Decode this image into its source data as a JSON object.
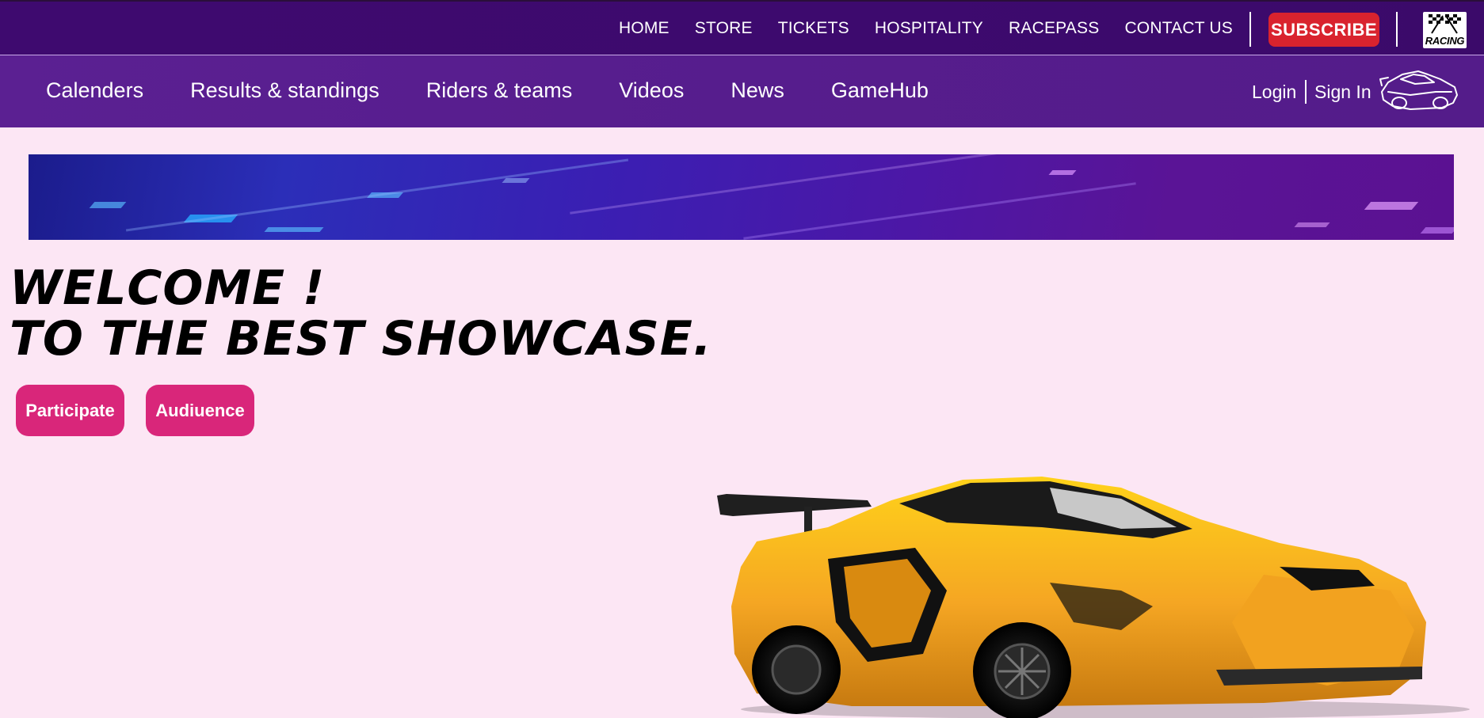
{
  "top_nav": {
    "links": [
      "HOME",
      "STORE",
      "TICKETS",
      "HOSPITALITY",
      "RACEPASS",
      "CONTACT US"
    ],
    "subscribe_label": "SUBSCRIBE",
    "logo_text": "RACING"
  },
  "main_nav": {
    "links": [
      "Calenders",
      "Results & standings",
      "Riders & teams",
      "Videos",
      "News",
      "GameHub"
    ],
    "login_label": "Login",
    "signin_label": "Sign In"
  },
  "hero": {
    "title_line1": "WELCOME !",
    "title_line2": "TO THE BEST SHOWCASE.",
    "buttons": [
      "Participate",
      "Audiuence"
    ]
  },
  "colors": {
    "top_bar": "#3e0a6f",
    "nav_bar": "#5b2092",
    "page_bg": "#fce6f4",
    "subscribe": "#d9232e",
    "pill_button": "#d9267a",
    "car_body": "#f5a623"
  },
  "icons": [
    "checkered-flags-icon",
    "sports-car-outline-icon"
  ]
}
